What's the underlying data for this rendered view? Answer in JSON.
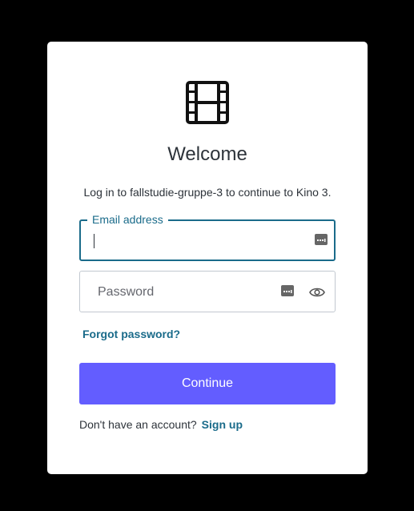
{
  "colors": {
    "backdrop": "#000000",
    "card": "#ffffff",
    "accent": "#635dff",
    "link": "#1a6b8a",
    "focus_border": "#1a6b8a"
  },
  "logo": {
    "icon": "film-icon"
  },
  "title": "Welcome",
  "subtitle": "Log in to fallstudie-gruppe-3 to continue to Kino 3.",
  "email": {
    "label": "Email address",
    "value": "",
    "icon": "keyboard-icon"
  },
  "password": {
    "placeholder": "Password",
    "value": "",
    "icons": [
      "keyboard-icon",
      "eye-icon"
    ]
  },
  "forgot_password": "Forgot password?",
  "continue_button": "Continue",
  "signup": {
    "prompt": "Don't have an account?",
    "link": "Sign up"
  }
}
